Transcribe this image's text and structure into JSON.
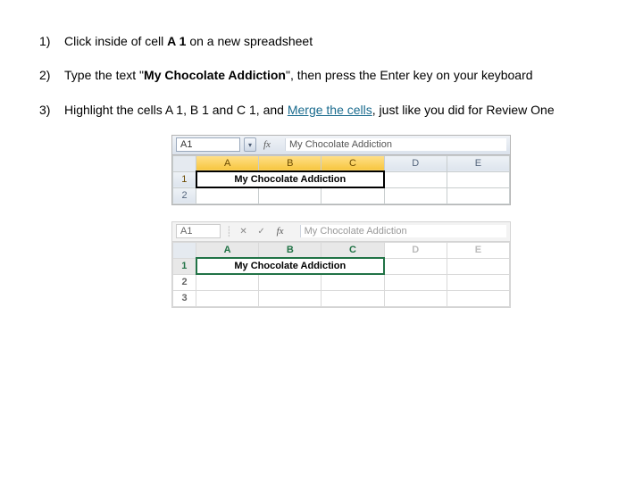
{
  "steps": [
    {
      "num": "1)",
      "pre": "Click inside of cell ",
      "code": "A 1",
      "post": " on a new spreadsheet"
    },
    {
      "num": "2)",
      "pre": "Type the text \"",
      "code": "My Chocolate Addiction",
      "post": "\", then press the Enter key on your keyboard"
    },
    {
      "num": "3)",
      "pre": "Highlight the cells A 1, B 1 and C 1, and ",
      "link": "Merge the cells",
      "post": ", just like you did for Review One"
    }
  ],
  "preview1": {
    "namebox": "A1",
    "fx": "fx",
    "formula": "My Chocolate Addiction",
    "cols": [
      "A",
      "B",
      "C",
      "D",
      "E"
    ],
    "rows": [
      "1",
      "2"
    ],
    "merged_text": "My Chocolate Addiction"
  },
  "preview2": {
    "namebox": "A1",
    "fx": "fx",
    "formula": "My Chocolate Addiction",
    "btn_x": "✕",
    "btn_check": "✓",
    "cols": [
      "",
      "A",
      "B",
      "C",
      "D",
      "E"
    ],
    "rows": [
      "1",
      "2",
      "3"
    ],
    "merged_text": "My Chocolate Addiction"
  }
}
